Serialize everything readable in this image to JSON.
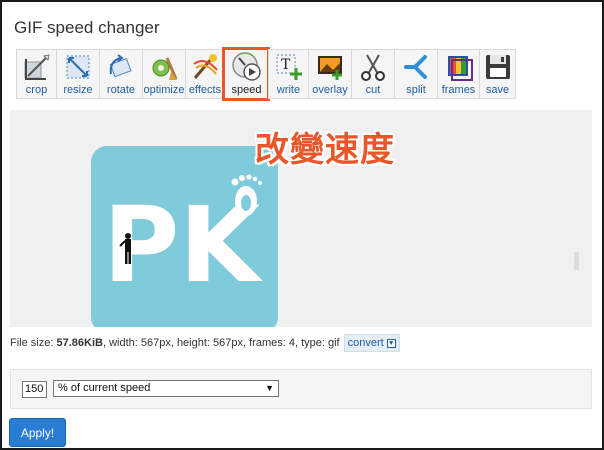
{
  "page": {
    "title": "GIF speed changer"
  },
  "toolbar": {
    "items": [
      {
        "label": "crop",
        "icon": "crop-icon"
      },
      {
        "label": "resize",
        "icon": "resize-icon"
      },
      {
        "label": "rotate",
        "icon": "rotate-icon"
      },
      {
        "label": "optimize",
        "icon": "optimize-icon"
      },
      {
        "label": "effects",
        "icon": "effects-icon"
      },
      {
        "label": "speed",
        "icon": "speed-icon",
        "active": true
      },
      {
        "label": "write",
        "icon": "write-icon"
      },
      {
        "label": "overlay",
        "icon": "overlay-icon"
      },
      {
        "label": "cut",
        "icon": "cut-icon"
      },
      {
        "label": "split",
        "icon": "split-icon"
      },
      {
        "label": "frames",
        "icon": "frames-icon"
      },
      {
        "label": "save",
        "icon": "save-icon"
      }
    ]
  },
  "preview": {
    "annotation": "改變速度",
    "logo_text": "PK",
    "logo_bg": "#7fcbdb",
    "annotation_color": "#e8562a",
    "highlight_color": "#e8562a"
  },
  "file_info": {
    "prefix": "File size: ",
    "size": "57.86KiB",
    "details": ", width: 567px, height: 567px, frames: 4, type: gif",
    "convert_label": "convert"
  },
  "speed_form": {
    "value": "150",
    "unit_option": "% of current speed"
  },
  "apply_button": {
    "label": "Apply!",
    "color": "#2a7dd4"
  }
}
